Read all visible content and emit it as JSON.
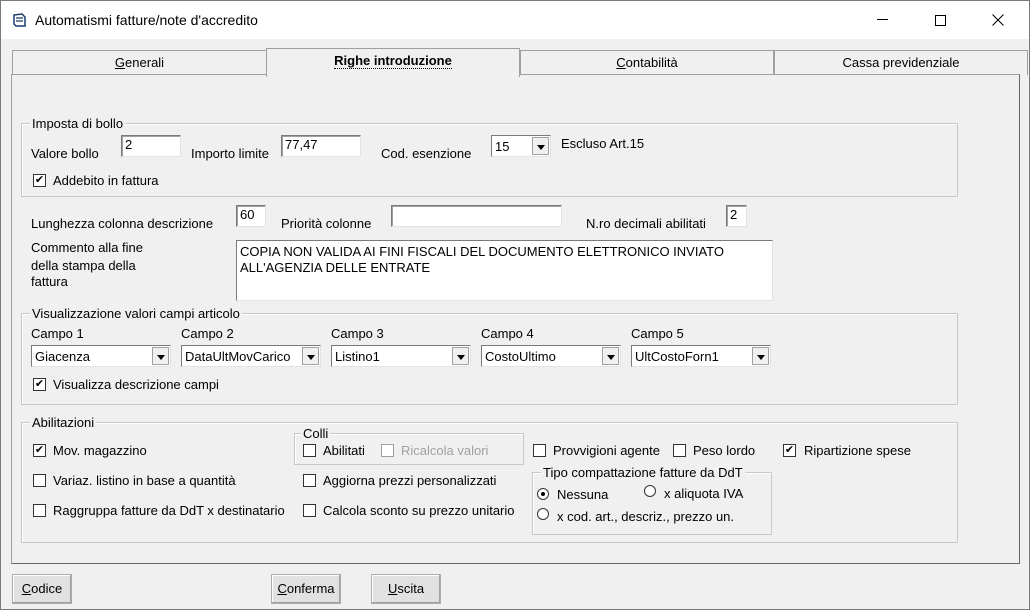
{
  "window": {
    "title": "Automatismi fatture/note d'accredito",
    "minimize": "—",
    "maximize": "☐",
    "close": "✕"
  },
  "tabs": [
    {
      "label": "Generali",
      "accel": "G",
      "rest": "enerali"
    },
    {
      "label": "Righe introduzione",
      "active": true
    },
    {
      "label": "Contabilità",
      "accel": "C",
      "rest": "ontabilità"
    },
    {
      "label": "Cassa previdenziale"
    }
  ],
  "bollo": {
    "group_label": "Imposta di bollo",
    "valore_label": "Valore bollo",
    "valore_value": "2",
    "importo_label": "Importo limite",
    "importo_value": "77,47",
    "cod_label": "Cod. esenzione",
    "cod_value": "15",
    "cod_desc": "Escluso Art.15",
    "addebito_label": "Addebito in fattura",
    "addebito_checked": true
  },
  "lunghezza_label": "Lunghezza colonna descrizione",
  "lunghezza_value": "60",
  "priorita_label": "Priorità colonne",
  "priorita_value": "",
  "decimali_label": "N.ro decimali abilitati",
  "decimali_value": "2",
  "commento": {
    "label_line1": "Commento alla fine",
    "label_line2": "della stampa della",
    "label_line3": "fattura",
    "line1": "COPIA NON VALIDA AI FINI FISCALI DEL DOCUMENTO ELETTRONICO INVIATO",
    "line2": "ALL'AGENZIA DELLE ENTRATE"
  },
  "campi": {
    "group_label": "Visualizzazione valori campi articolo",
    "items": [
      {
        "label": "Campo 1",
        "value": "Giacenza"
      },
      {
        "label": "Campo 2",
        "value": "DataUltMovCarico"
      },
      {
        "label": "Campo 3",
        "value": "Listino1"
      },
      {
        "label": "Campo 4",
        "value": "CostoUltimo"
      },
      {
        "label": "Campo 5",
        "value": "UltCostoForn1"
      }
    ],
    "visualizza_label": "Visualizza descrizione campi",
    "visualizza_checked": true
  },
  "abilitazioni": {
    "group_label": "Abilitazioni",
    "mov_magazzino": "Mov. magazzino",
    "variaz_listino": "Variaz. listino in base a quantità",
    "raggruppa": "Raggruppa fatture da DdT x destinatario",
    "colli_label": "Colli",
    "abilitati": "Abilitati",
    "ricalcola": "Ricalcola valori",
    "aggiorna_prezzi": "Aggiorna prezzi personalizzati",
    "calcola_sconto": "Calcola sconto su prezzo unitario",
    "provvigioni": "Provvigioni agente",
    "peso_lordo": "Peso lordo",
    "ripartizione": "Ripartizione spese",
    "compattazione_label": "Tipo compattazione fatture da DdT",
    "nessuna": "Nessuna",
    "aliquota": "x aliquota IVA",
    "cod_art": "x cod. art., descriz., prezzo un."
  },
  "buttons": {
    "codice": {
      "accel": "C",
      "rest": "odice"
    },
    "conferma": {
      "accel": "C",
      "rest": "onferma"
    },
    "uscita": {
      "accel": "U",
      "rest": "scita"
    }
  },
  "check_mark": "✔"
}
